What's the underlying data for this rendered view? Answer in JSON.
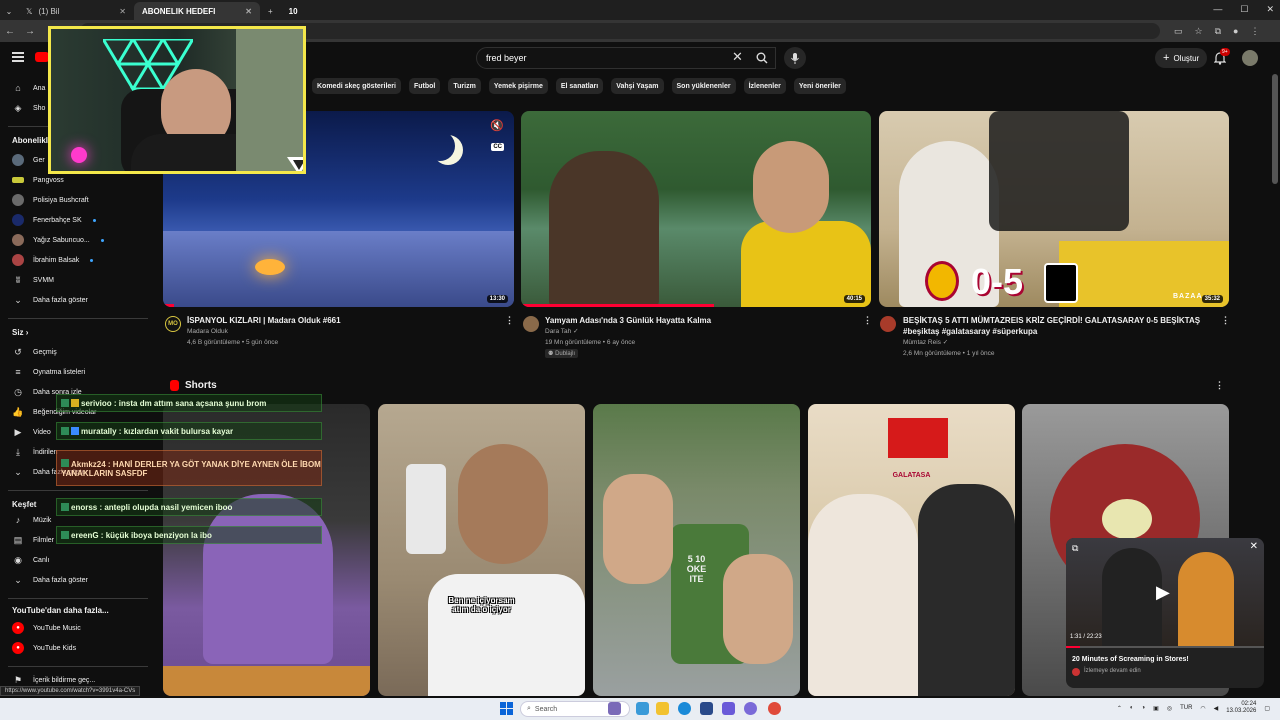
{
  "browser": {
    "tabs": [
      {
        "label": "(1) Bil",
        "active": false
      },
      {
        "label": "ABONELIK HEDEFI",
        "active": true
      },
      {
        "label": "10",
        "active": false
      }
    ]
  },
  "youtube": {
    "search": {
      "value": "fred beyer"
    },
    "create_label": "Oluştur",
    "notif_count": "9+",
    "chips": [
      "Komedi skeç gösterileri",
      "Futbol",
      "Turizm",
      "Yemek pişirme",
      "El sanatları",
      "Vahşi Yaşam",
      "Son yüklenenler",
      "İzlenenler",
      "Yeni öneriler"
    ],
    "sidebar": {
      "top": [
        {
          "label": "Ana",
          "icon": "home-icon"
        },
        {
          "label": "Sho",
          "icon": "shorts-icon"
        }
      ],
      "subs_header": "Abonelikle",
      "subs": [
        {
          "label": "Ger",
          "color": "#5a6a7a",
          "dot": false
        },
        {
          "label": "Pangvoss",
          "color": "#c9c93a",
          "dot": false
        },
        {
          "label": "Polisiya Bushcraft",
          "color": "#6a6a6a",
          "dot": false
        },
        {
          "label": "Fenerbahçe SK",
          "color": "#1a2a6a",
          "dot": true
        },
        {
          "label": "Yağız Sabuncuo...",
          "color": "#8a6a5a",
          "dot": true
        },
        {
          "label": "İbrahim Balsak",
          "color": "#aa4444",
          "dot": true
        },
        {
          "label": "SVMM",
          "color": "#222222",
          "dot": false
        }
      ],
      "more_subs": "Daha fazla göster",
      "you_header": "Siz",
      "you": [
        {
          "label": "Geçmiş",
          "icon": "history-icon"
        },
        {
          "label": "Oynatma listeleri",
          "icon": "playlist-icon"
        },
        {
          "label": "Daha sonra izle",
          "icon": "watch-later-icon"
        },
        {
          "label": "Beğendiğim videolar",
          "icon": "like-icon"
        },
        {
          "label": "Video",
          "icon": "video-icon"
        },
        {
          "label": "İndirilen",
          "icon": "download-icon"
        },
        {
          "label": "Daha fazla göster",
          "icon": "chevron-down-icon"
        }
      ],
      "explore_header": "Keşfet",
      "explore": [
        {
          "label": "Müzik",
          "icon": "music-icon"
        },
        {
          "label": "Filmler",
          "icon": "film-icon"
        },
        {
          "label": "Canlı",
          "icon": "live-icon"
        },
        {
          "label": "Daha fazla göster",
          "icon": "chevron-down-icon"
        }
      ],
      "more_header": "YouTube'dan daha fazla...",
      "more": [
        {
          "label": "YouTube Music",
          "icon": "yt-music-icon"
        },
        {
          "label": "YouTube Kids",
          "icon": "yt-kids-icon"
        }
      ],
      "report": "İçerik bildirme geç..."
    },
    "videos": [
      {
        "title": "İSPANYOL KIZLARI | Madara Olduk #661",
        "channel": "Madara Olduk",
        "meta": "4,6 B görüntüleme • 5 gün önce",
        "duration": "13:30",
        "progress": 0.03
      },
      {
        "title": "Yamyam Adası'nda 3 Günlük Hayatta Kalma",
        "channel": "Dara Tah",
        "meta": "19 Mn görüntüleme • 6 ay önce",
        "duration": "40:15",
        "badge": "Dublajlı",
        "progress": 0.55
      },
      {
        "title": "BEŞİKTAŞ 5 ATTI MÜMTAZREIS  KRİZ GEÇİRDİ! GALATASARAY 0-5 BEŞİKTAŞ",
        "title2": "#beşiktaş #galatasaray #süperkupa",
        "channel": "Mümtaz Reis",
        "meta": "2,6 Mn görüntüleme • 1 yıl önce",
        "duration": "35:32",
        "overlay_text": "0-5",
        "brand_text": "BAZAA",
        "progress": 0
      }
    ],
    "shorts_header": "Shorts",
    "shorts": [
      {
        "caption": ""
      },
      {
        "caption": "Ben ne içiyorsam\natım da o içiyor"
      },
      {
        "caption": "5 10\nOKE\nITE"
      },
      {
        "caption": "GALATASA"
      },
      {
        "caption": ""
      }
    ],
    "miniplayer": {
      "title": "20 Minutes of Screaming in Stores!",
      "subtitle": "İzlemeye devam edin",
      "time": "1:31 / 22:23"
    }
  },
  "chat": [
    {
      "user": "serivioo",
      "text": "insta dm attım sana açsana şunu brom"
    },
    {
      "user": "muratally",
      "text": "kızlardan vakit bulursa kayar"
    },
    {
      "user": "Akmkz24",
      "text": "HANİ DERLER YA GÖT YANAK DİYE AYNEN ÖLE İBOM",
      "text2": "YANAKLARIN SASFDF"
    },
    {
      "user": "enorss",
      "text": "antepli olupda nasil yemicen iboo"
    },
    {
      "user": "ereenG",
      "text": "küçük iboya benziyon la ibo"
    }
  ],
  "status_url": "https://www.youtube.com/watch?v=3991v4a-CVs",
  "taskbar": {
    "search_placeholder": "Search",
    "lang": "TUR",
    "time": "02:24",
    "date": "13.03.2026"
  },
  "colors": {
    "accent_red": "#ff0000",
    "webcam_border": "#f4e84a",
    "chat_green": "#2e8b57"
  }
}
